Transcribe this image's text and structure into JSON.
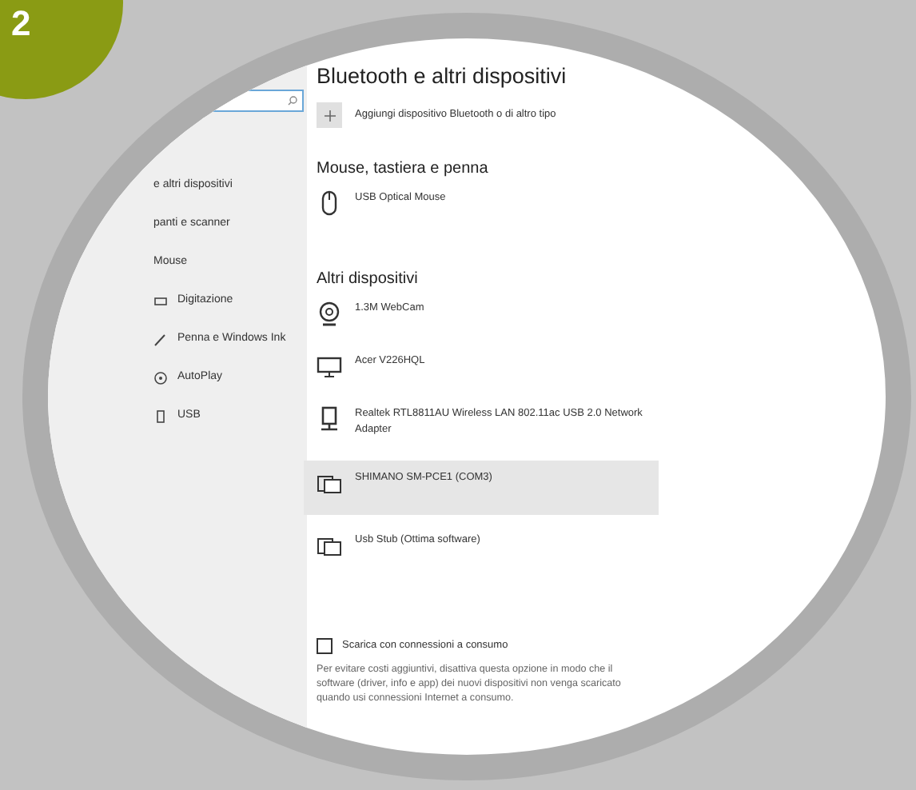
{
  "step_badge": "2",
  "sidebar": {
    "items": [
      {
        "label": "e altri dispositivi",
        "kind": "plain"
      },
      {
        "label": "panti e scanner",
        "kind": "plain"
      },
      {
        "label": "Mouse",
        "kind": "plain"
      },
      {
        "label": "Digitazione",
        "kind": "keyboard"
      },
      {
        "label": "Penna e Windows Ink",
        "kind": "pen"
      },
      {
        "label": "AutoPlay",
        "kind": "autoplay"
      },
      {
        "label": "USB",
        "kind": "usb"
      }
    ]
  },
  "title": "Bluetooth e altri dispositivi",
  "add_button": {
    "label": "Aggiungi dispositivo Bluetooth o di altro tipo"
  },
  "sections": [
    {
      "heading": "Mouse, tastiera e penna",
      "devices": [
        {
          "name": "USB Optical Mouse",
          "kind": "mouse",
          "selected": false
        }
      ]
    },
    {
      "heading": "Altri dispositivi",
      "devices": [
        {
          "name": "1.3M WebCam",
          "kind": "webcam",
          "selected": false
        },
        {
          "name": "Acer V226HQL",
          "kind": "monitor",
          "selected": false
        },
        {
          "name": "Realtek RTL8811AU Wireless LAN 802.11ac USB 2.0 Network Adapter",
          "kind": "adapter",
          "selected": false
        },
        {
          "name": "SHIMANO SM-PCE1 (COM3)",
          "kind": "device",
          "selected": true
        },
        {
          "name": "Usb Stub (Ottima software)",
          "kind": "device",
          "selected": false
        }
      ]
    }
  ],
  "metered": {
    "label": "Scarica con connessioni a consumo",
    "checked": false,
    "description": "Per evitare costi aggiuntivi, disattiva questa opzione in modo che il software (driver, info e app) dei nuovi dispositivi non venga scaricato quando usi connessioni Internet a consumo."
  }
}
